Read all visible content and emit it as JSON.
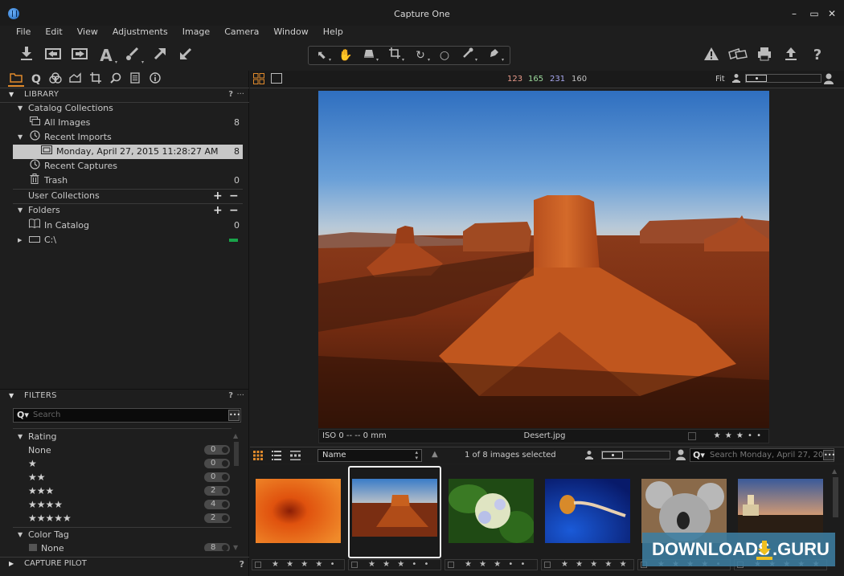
{
  "window": {
    "title": "Capture One",
    "controls": {
      "minimize": "–",
      "maximize": "▭",
      "close": "✕"
    }
  },
  "menu": [
    "File",
    "Edit",
    "View",
    "Adjustments",
    "Image",
    "Camera",
    "Window",
    "Help"
  ],
  "toolbar": {
    "left_icons": [
      "import-icon",
      "previous-variant-icon",
      "next-variant-icon",
      "text-annotation-icon",
      "brush-icon",
      "redo-arrow-icon",
      "undo-arrow-icon"
    ],
    "cursor_tools": [
      "select-cursor-icon",
      "pan-hand-icon",
      "keystone-icon",
      "crop-icon",
      "rotate-icon",
      "circle-spot-icon",
      "color-picker-icon",
      "local-adjust-icon"
    ],
    "right_icons": [
      "warning-icon",
      "compare-icon",
      "print-icon",
      "export-icon",
      "help-icon"
    ]
  },
  "tool_tabs": [
    "library-tab",
    "capture-tab",
    "color-tab",
    "exposure-tab",
    "lens-crop-tab",
    "details-tab",
    "metadata-tab",
    "info-tab"
  ],
  "library": {
    "header": "LIBRARY",
    "help": "?",
    "more": "···",
    "catalog_collections": "Catalog Collections",
    "all_images": {
      "label": "All Images",
      "count": "8"
    },
    "recent_imports": "Recent Imports",
    "recent_import_entry": {
      "label": "Monday, April 27, 2015 11:28:27 AM",
      "count": "8"
    },
    "recent_captures": "Recent Captures",
    "trash": {
      "label": "Trash",
      "count": "0"
    },
    "user_collections": "User Collections",
    "folders": "Folders",
    "in_catalog": {
      "label": "In Catalog",
      "count": "0"
    },
    "drive": {
      "label": "C:\\",
      "status_color": "#19a34a"
    }
  },
  "filters": {
    "header": "FILTERS",
    "help": "?",
    "more": "···",
    "search_placeholder": "Search",
    "rating_label": "Rating",
    "ratings": [
      {
        "label": "None",
        "stars": "",
        "count": "0"
      },
      {
        "label": "",
        "stars": "★",
        "count": "0"
      },
      {
        "label": "",
        "stars": "★★",
        "count": "0"
      },
      {
        "label": "",
        "stars": "★★★",
        "count": "2"
      },
      {
        "label": "",
        "stars": "★★★★",
        "count": "4"
      },
      {
        "label": "",
        "stars": "★★★★★",
        "count": "2"
      }
    ],
    "color_tag_label": "Color Tag",
    "color_tags": [
      {
        "label": "None",
        "count": "8"
      }
    ]
  },
  "capture_pilot": {
    "header": "CAPTURE PILOT",
    "help": "?"
  },
  "viewer": {
    "rgb": {
      "r": "123",
      "g": "165",
      "b": "231",
      "l": "160"
    },
    "rgb_colors": {
      "r": "#e89a8a",
      "g": "#9ad89a",
      "b": "#a8a8f0",
      "l": "#c0c0c0"
    },
    "zoom_label": "Fit",
    "caption": {
      "meta": "ISO 0 -- -- 0 mm",
      "filename": "Desert.jpg",
      "rating": "★ ★ ★ • •"
    }
  },
  "browser": {
    "sort_field": "Name",
    "selection_status": "1 of 8 images selected",
    "search_placeholder": "Search Monday, April 27, 20",
    "thumbnails": [
      {
        "name": "chrysanthemum-thumb",
        "rating": "★ ★ ★ ★ •",
        "selected": false
      },
      {
        "name": "desert-thumb",
        "rating": "★ ★ ★ • •",
        "selected": true
      },
      {
        "name": "hydrangeas-thumb",
        "rating": "★ ★ ★ • •",
        "selected": false
      },
      {
        "name": "jellyfish-thumb",
        "rating": "★ ★ ★ ★ ★",
        "selected": false
      },
      {
        "name": "koala-thumb",
        "rating": "★ ★ ★ ★ •",
        "selected": false
      },
      {
        "name": "lighthouse-thumb",
        "rating": "★ ★ ★ ★ ★",
        "selected": false
      }
    ]
  },
  "watermark": {
    "left": "DOWNLOADS",
    "right": ".GURU"
  },
  "accent_color": "#e08a2c"
}
